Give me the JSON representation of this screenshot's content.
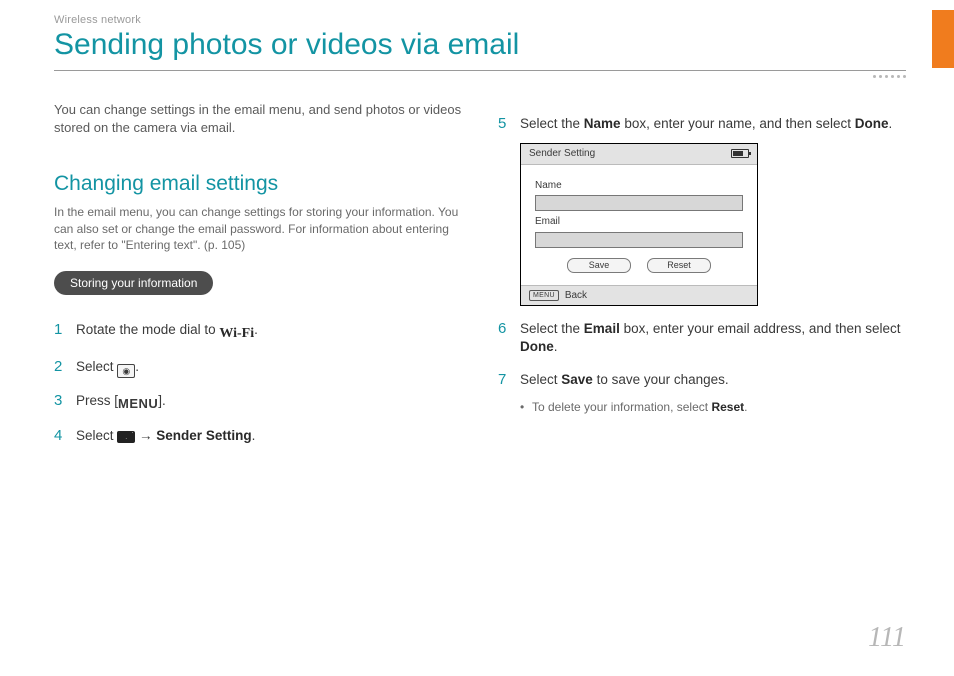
{
  "header": {
    "breadcrumb": "Wireless network",
    "title": "Sending photos or videos via email"
  },
  "left": {
    "intro": "You can change settings in the email menu, and send photos or videos stored on the camera via email.",
    "section_heading": "Changing email settings",
    "section_note": "In the email menu, you can change settings for storing your information. You can also set or change the email password. For information about entering text, refer to \"Entering text\". (p. 105)",
    "pill": "Storing your information",
    "steps": {
      "s1_pre": "Rotate the mode dial to ",
      "s1_icon": "Wi-Fi",
      "s1_post": ".",
      "s2_pre": "Select ",
      "s2_icon": "◉",
      "s2_post": ".",
      "s3_pre": "Press [",
      "s3_icon": "MENU",
      "s3_post": "].",
      "s4_pre": "Select ",
      "s4_arrow": " → ",
      "s4_bold": "Sender Setting",
      "s4_post": "."
    }
  },
  "right": {
    "steps": {
      "s5_pre": "Select the ",
      "s5_b1": "Name",
      "s5_mid": " box, enter your name, and then select ",
      "s5_b2": "Done",
      "s5_post": ".",
      "s6_pre": "Select the ",
      "s6_b1": "Email",
      "s6_mid": " box, enter your email address, and then select ",
      "s6_b2": "Done",
      "s6_post": ".",
      "s7_pre": "Select ",
      "s7_b1": "Save",
      "s7_post": " to save your changes."
    },
    "bullet_pre": "To delete your information, select ",
    "bullet_b": "Reset",
    "bullet_post": "."
  },
  "device": {
    "title": "Sender Setting",
    "name_label": "Name",
    "email_label": "Email",
    "save": "Save",
    "reset": "Reset",
    "menu_chip": "MENU",
    "back": "Back"
  },
  "page_number": "111"
}
